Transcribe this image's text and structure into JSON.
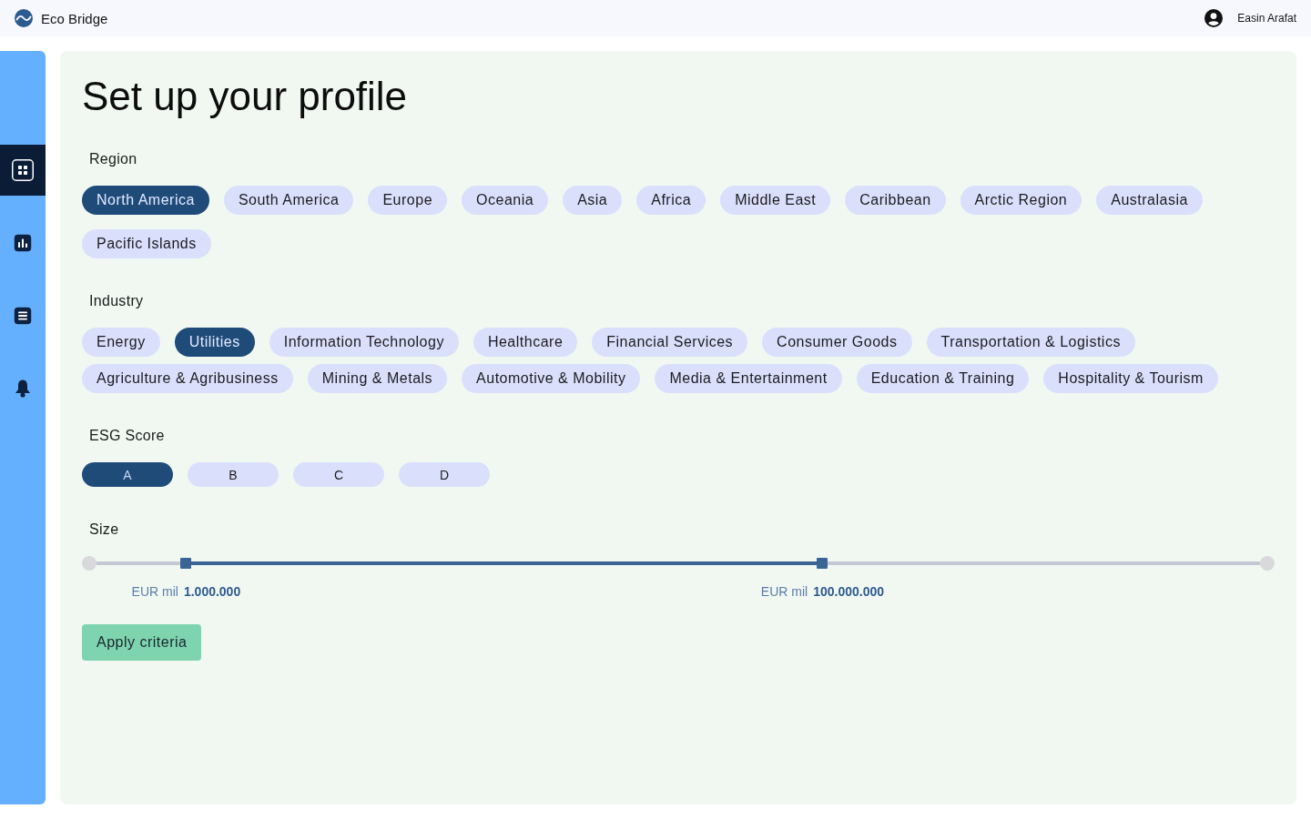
{
  "app": {
    "name": "Eco Bridge"
  },
  "user": {
    "name": "Easin Arafat"
  },
  "sidebar": {
    "items": [
      {
        "kind": "grid",
        "selected": true
      },
      {
        "kind": "chart",
        "selected": false
      },
      {
        "kind": "document",
        "selected": false
      },
      {
        "kind": "bell",
        "selected": false
      }
    ]
  },
  "page": {
    "title": "Set up your profile"
  },
  "region": {
    "label": "Region",
    "options": [
      {
        "label": "North America",
        "selected": true
      },
      {
        "label": "South America",
        "selected": false
      },
      {
        "label": "Europe",
        "selected": false
      },
      {
        "label": "Oceania",
        "selected": false
      },
      {
        "label": "Asia",
        "selected": false
      },
      {
        "label": "Africa",
        "selected": false
      },
      {
        "label": "Middle East",
        "selected": false
      },
      {
        "label": "Caribbean",
        "selected": false
      },
      {
        "label": "Arctic Region",
        "selected": false
      },
      {
        "label": "Australasia",
        "selected": false
      },
      {
        "label": "Pacific Islands",
        "selected": false
      }
    ]
  },
  "industry": {
    "label": "Industry",
    "options": [
      {
        "label": "Energy",
        "selected": false
      },
      {
        "label": "Utilities",
        "selected": true
      },
      {
        "label": "Information Technology",
        "selected": false
      },
      {
        "label": "Healthcare",
        "selected": false
      },
      {
        "label": "Financial Services",
        "selected": false
      },
      {
        "label": "Consumer Goods",
        "selected": false
      },
      {
        "label": "Transportation & Logistics",
        "selected": false
      },
      {
        "label": "Agriculture & Agribusiness",
        "selected": false
      },
      {
        "label": "Mining & Metals",
        "selected": false
      },
      {
        "label": "Automotive & Mobility",
        "selected": false
      },
      {
        "label": "Media & Entertainment",
        "selected": false
      },
      {
        "label": "Education & Training",
        "selected": false
      },
      {
        "label": "Hospitality & Tourism",
        "selected": false
      }
    ]
  },
  "esg_score": {
    "label": "ESG Score",
    "options": [
      {
        "label": "A",
        "selected": true
      },
      {
        "label": "B",
        "selected": false
      },
      {
        "label": "C",
        "selected": false
      },
      {
        "label": "D",
        "selected": false
      }
    ]
  },
  "size": {
    "label": "Size",
    "thumbs": [
      {
        "level": 0.077,
        "unit": "EUR mil",
        "value": "1.000.000"
      },
      {
        "level": 0.624,
        "unit": "EUR mil",
        "value": "100.000.000"
      }
    ]
  },
  "apply_button": {
    "label": "Apply criteria"
  }
}
